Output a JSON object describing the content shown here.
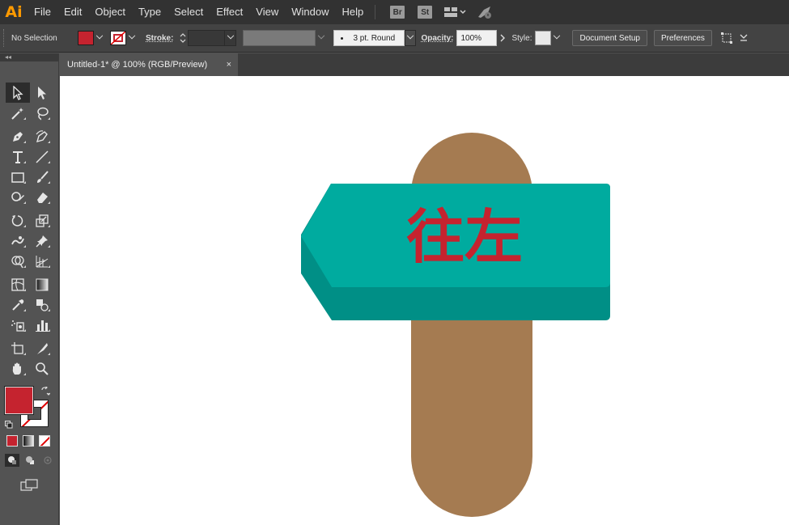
{
  "app": {
    "logo": "Ai"
  },
  "menu": {
    "items": [
      "File",
      "Edit",
      "Object",
      "Type",
      "Select",
      "Effect",
      "View",
      "Window",
      "Help"
    ]
  },
  "app_switcher": {
    "bridge": "Br",
    "stock": "St"
  },
  "control_bar": {
    "selection_status": "No Selection",
    "fill_color": "#c5232f",
    "stroke_label": "Stroke:",
    "brush_value": "3 pt. Round",
    "opacity_label": "Opacity:",
    "opacity_value": "100%",
    "style_label": "Style:",
    "document_setup_label": "Document Setup",
    "preferences_label": "Preferences"
  },
  "tabs": [
    {
      "label": "Untitled-1* @ 100% (RGB/Preview)",
      "close": "×"
    }
  ],
  "tools_panel": {
    "collapse_glyph": "◂◂"
  },
  "colors": {
    "fill": "#c5232f",
    "post": "#a57b51",
    "sign_face": "#00ab9f",
    "sign_side": "#008f86",
    "sign_text": "#c5232f"
  },
  "artwork": {
    "sign_text": "往左"
  }
}
